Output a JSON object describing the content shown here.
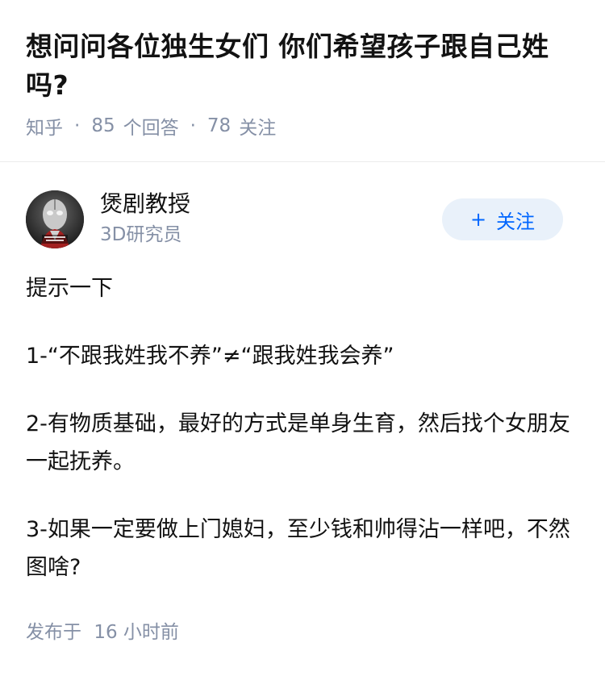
{
  "question": {
    "title": "想问问各位独生女们 你们希望孩子跟自己姓吗?",
    "source": "知乎",
    "answer_count": "85",
    "answer_label": "个回答",
    "follow_count": "78",
    "follow_label": "关注"
  },
  "author": {
    "name": "煲剧教授",
    "headline": "3D研究员",
    "avatar_icon": "superhero-avatar-icon",
    "follow_button": "关注"
  },
  "answer": {
    "paragraphs": [
      "提示一下",
      "1-“不跟我姓我不养”≠“跟我姓我会养”",
      "2-有物质基础，最好的方式是单身生育，然后找个女朋友一起抚养。",
      "3-如果一定要做上门媳妇，至少钱和帅得沾一样吧，不然图啥?"
    ],
    "published_label": "发布于",
    "published_time": "16 小时前"
  },
  "colors": {
    "meta_gray": "#8590a6",
    "brand_blue": "#0066ff",
    "button_bg": "#e9f1fa",
    "text": "#121212"
  }
}
